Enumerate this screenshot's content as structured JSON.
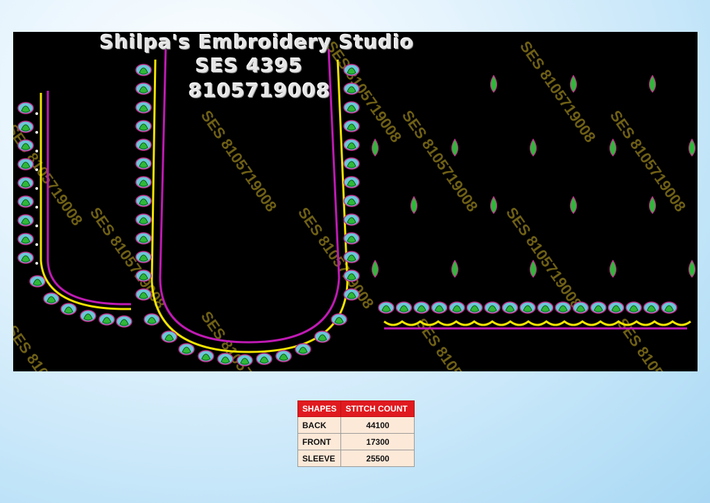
{
  "header": {
    "studio_name": "Shilpa's Embroidery Studio",
    "design_code": "SES 4395",
    "phone": "8105719008"
  },
  "watermark": "SES 8105719008",
  "colors": {
    "background": "#000000",
    "neck_outline": "#c01ab4",
    "scallop": "#f2e400",
    "leaf": "#2fb83a",
    "flower": "#6cc6d8",
    "bead": "#f0f0f0",
    "watermark": "#7a6a18",
    "table_header": "#e01a1f",
    "table_cell": "#fde9d8"
  },
  "table": {
    "headers": [
      "SHAPES",
      "STITCH COUNT"
    ],
    "rows": [
      {
        "shape": "BACK",
        "count": "44100"
      },
      {
        "shape": "FRONT",
        "count": "17300"
      },
      {
        "shape": "SLEEVE",
        "count": "25500"
      }
    ]
  }
}
